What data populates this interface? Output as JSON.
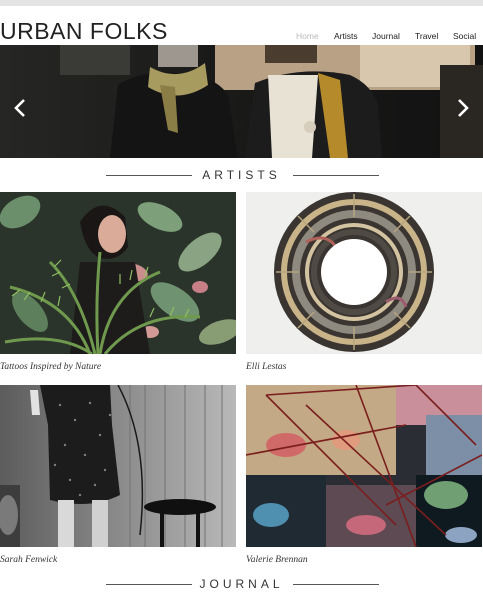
{
  "site": {
    "logo": "URBAN FOLKS"
  },
  "nav": {
    "items": [
      {
        "label": "Home",
        "active": true
      },
      {
        "label": "Artists"
      },
      {
        "label": "Journal"
      },
      {
        "label": "Travel"
      },
      {
        "label": "Social"
      }
    ]
  },
  "hero": {
    "prev_icon": "chevron-left-icon",
    "next_icon": "chevron-right-icon"
  },
  "sections": {
    "artists_title": "ARTISTS",
    "journal_title": "JOURNAL"
  },
  "artists": [
    {
      "caption": "Tattoos Inspired by Nature"
    },
    {
      "caption": "Elli Lestas"
    },
    {
      "caption": "Sarah Fenwick"
    },
    {
      "caption": "Valerie Brennan"
    }
  ],
  "colors": {
    "nav_active": "#b9b9b9",
    "text": "#222222",
    "rule": "#555555"
  }
}
